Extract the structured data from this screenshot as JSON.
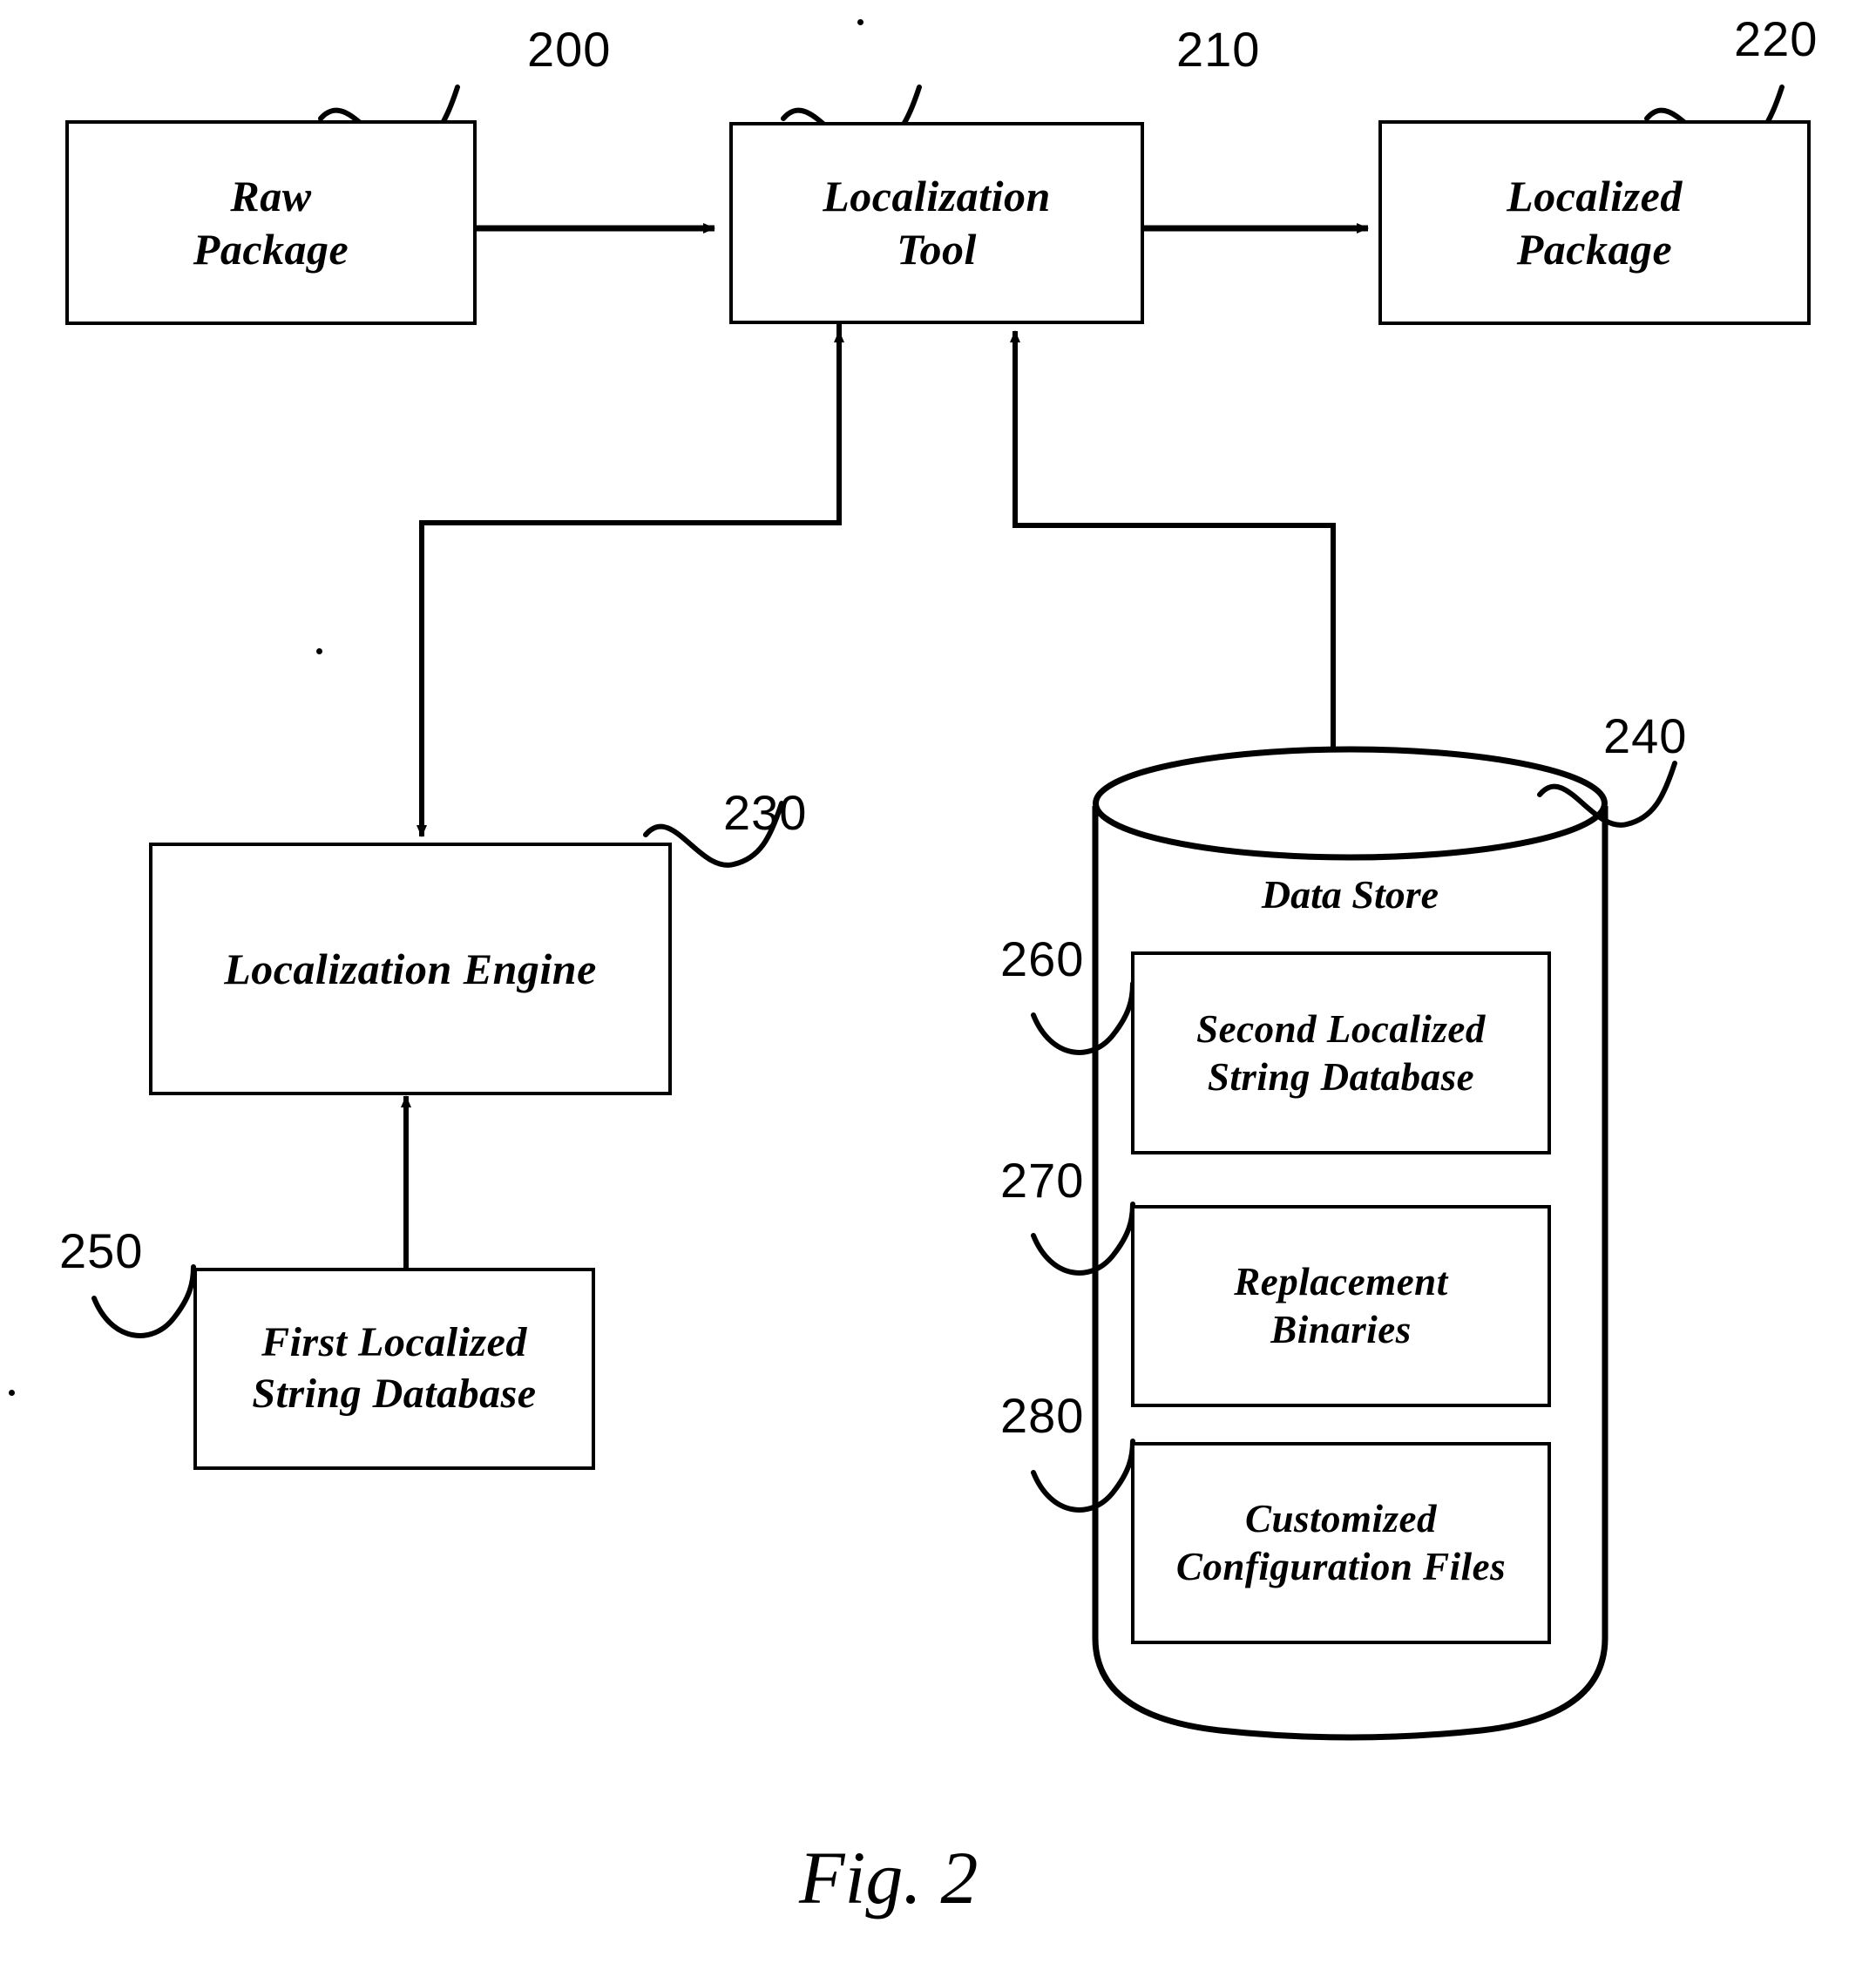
{
  "figure": {
    "caption": "Fig. 2",
    "type": "patent-block-diagram"
  },
  "nodes": {
    "raw_package": {
      "label_line1": "Raw",
      "label_line2": "Package",
      "ref": "200"
    },
    "localization_tool": {
      "label_line1": "Localization",
      "label_line2": "Tool",
      "ref": "210"
    },
    "localized_package": {
      "label_line1": "Localized",
      "label_line2": "Package",
      "ref": "220"
    },
    "localization_engine": {
      "label_line1": "Localization Engine",
      "label_line2": "",
      "ref": "230"
    },
    "first_localized_string_database": {
      "label_line1": "First Localized",
      "label_line2": "String Database",
      "ref": "250"
    },
    "data_store": {
      "label_line1": "Data Store",
      "label_line2": "",
      "ref": "240"
    },
    "second_localized_string_database": {
      "label_line1": "Second Localized",
      "label_line2": "String Database",
      "ref": "260"
    },
    "replacement_binaries": {
      "label_line1": "Replacement",
      "label_line2": "Binaries",
      "ref": "270"
    },
    "customized_configuration_files": {
      "label_line1": "Customized",
      "label_line2": "Configuration Files",
      "ref": "280"
    }
  },
  "connections": [
    {
      "from": "raw_package",
      "to": "localization_tool",
      "style": "arrow-right"
    },
    {
      "from": "localization_tool",
      "to": "localized_package",
      "style": "arrow-right"
    },
    {
      "from": "localization_tool",
      "to": "localization_engine",
      "style": "arrow-down-elbow"
    },
    {
      "from": "localization_engine",
      "to": "localization_tool",
      "style": "arrow-up-elbow"
    },
    {
      "from": "data_store",
      "to": "localization_tool",
      "style": "arrow-up-elbow"
    },
    {
      "from": "first_localized_string_database",
      "to": "localization_engine",
      "style": "arrow-up"
    }
  ],
  "colors": {
    "stroke": "#000000",
    "background": "#ffffff"
  }
}
